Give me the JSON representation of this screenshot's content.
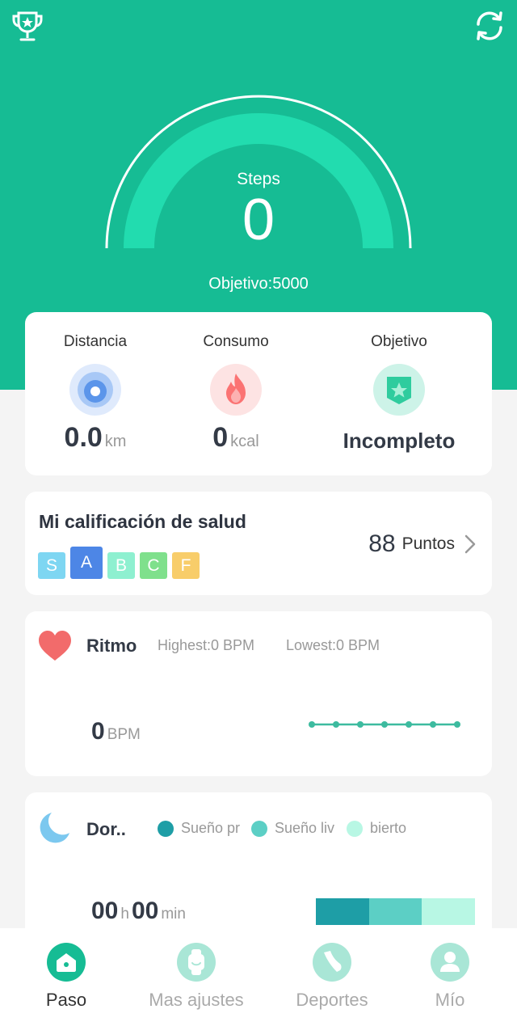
{
  "header": {
    "steps_label": "Steps",
    "steps_value": "0",
    "goal_text": "Objetivo:5000"
  },
  "stats": {
    "distance": {
      "label": "Distancia",
      "value": "0.0",
      "unit": "km"
    },
    "consumption": {
      "label": "Consumo",
      "value": "0",
      "unit": "kcal"
    },
    "goal": {
      "label": "Objetivo",
      "value": "Incompleto"
    }
  },
  "health": {
    "title": "Mi calificación de salud",
    "grades": [
      "S",
      "A",
      "B",
      "C",
      "F"
    ],
    "active_grade": "A",
    "points_value": "88",
    "points_label": "Puntos"
  },
  "heart": {
    "title": "Ritmo",
    "highest": "Highest:0  BPM",
    "lowest": "Lowest:0  BPM",
    "value": "0",
    "unit": "BPM"
  },
  "sleep": {
    "title": "Dor..",
    "legend": [
      "Sueño pr",
      "Sueño liv",
      "bierto"
    ],
    "hours": "00",
    "hours_unit": "h",
    "minutes": "00",
    "minutes_unit": "min"
  },
  "nav": [
    {
      "label": "Paso",
      "active": true
    },
    {
      "label": "Mas ajustes",
      "active": false
    },
    {
      "label": "Deportes",
      "active": false
    },
    {
      "label": "Mío",
      "active": false
    }
  ],
  "colors": {
    "primary": "#16bc94",
    "gauge_fill": "#22dcaf",
    "deep_sleep": "#1e9ea6",
    "light_sleep": "#5ccfc5",
    "awake": "#b8f7e4",
    "grade_S": "#7ed6f2",
    "grade_A": "#4d86e6",
    "grade_B": "#8ef0d0",
    "grade_C": "#7fe08c",
    "grade_F": "#f8cd6a"
  }
}
